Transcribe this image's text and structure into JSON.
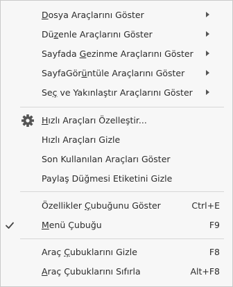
{
  "menu": {
    "items": [
      {
        "pre": "",
        "u": "D",
        "post": "osya Araçlarını Göster",
        "submenu": true
      },
      {
        "pre": "Dü",
        "u": "z",
        "post": "enle Araçlarını Göster",
        "submenu": true
      },
      {
        "pre": "Sayfada ",
        "u": "G",
        "post": "ezinme Araçlarını Göster",
        "submenu": true
      },
      {
        "pre": "SayfaGör",
        "u": "ü",
        "post": "ntüle Araçlarını Göster",
        "submenu": true
      },
      {
        "pre": "Se",
        "u": "ç",
        "post": " ve Yakınlaştır Araçlarını Göster",
        "submenu": true
      },
      {
        "pre": "",
        "u": "H",
        "post": "ızlı Araçları Özelleştir...",
        "icon": "gear-icon"
      },
      {
        "pre": "Hızlı Araçları Gizle"
      },
      {
        "pre": "Son Kullanılan Araçları Göster"
      },
      {
        "pre": "Paylaş Düğmesi Etiketini Gizle"
      },
      {
        "pre": "Özellikler ",
        "u": "Ç",
        "post": "ubuğunu Göster",
        "shortcut": "Ctrl+E"
      },
      {
        "pre": "",
        "u": "M",
        "post": "enü Çubuğu",
        "shortcut": "F9",
        "checked": true,
        "icon": "checkmark-icon"
      },
      {
        "pre": "Araç ",
        "u": "Ç",
        "post": "ubuklarını Gizle",
        "shortcut": "F8"
      },
      {
        "pre": "",
        "u": "A",
        "post": "raç Çubuklarını Sıfırla",
        "shortcut": "Alt+F8"
      }
    ]
  }
}
